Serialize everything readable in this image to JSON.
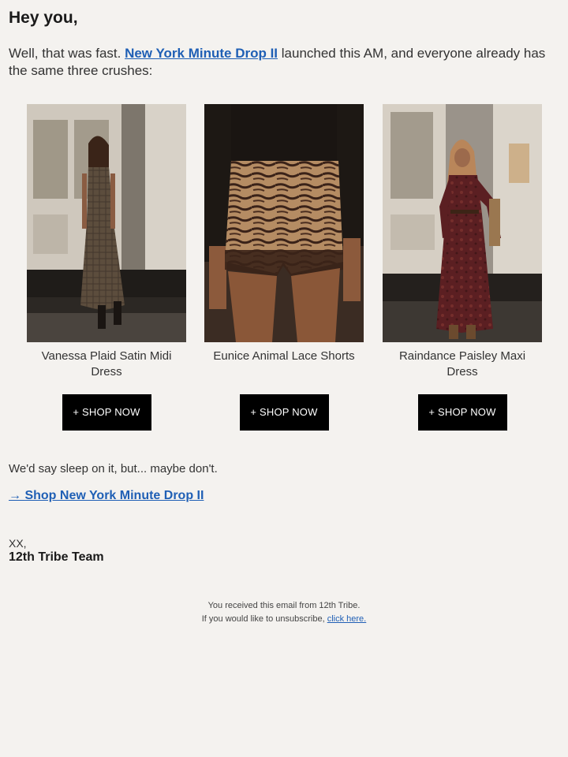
{
  "greeting": "Hey you,",
  "intro": {
    "before": "Well, that was fast. ",
    "link_text": "New York Minute Drop II",
    "after": " launched this AM, and everyone already has the same three crushes:"
  },
  "products": [
    {
      "name": "Vanessa Plaid Satin Midi Dress",
      "button": "+ SHOP NOW",
      "colors": {
        "bg": "#7a746b",
        "door": "#d6d0c6",
        "dress": "#5a4b3c",
        "step": "#2a2622"
      }
    },
    {
      "name": "Eunice Animal Lace Shorts",
      "button": "+ SHOP NOW",
      "colors": {
        "bg": "#3a2a20",
        "top": "#1b1613",
        "skin": "#8c5a3c",
        "print": "#b08a62",
        "lace": "#3b2418"
      }
    },
    {
      "name": "Raindance Paisley Maxi Dress",
      "button": "+ SHOP NOW",
      "colors": {
        "bg": "#9a938a",
        "door": "#dcd6cc",
        "dress": "#5b1f22",
        "step": "#2b2724"
      }
    }
  ],
  "closing": "We'd say sleep on it, but... maybe don't.",
  "cta": {
    "arrow": "→",
    "text": "Shop New York Minute Drop II"
  },
  "signoff": {
    "xx": "XX,",
    "team": "12th Tribe Team"
  },
  "footer": {
    "line1": "You received this email from 12th Tribe.",
    "line2_before": "If you would like to unsubscribe, ",
    "unsubscribe_link": "click here."
  },
  "colors": {
    "background": "#f4f2ef",
    "link": "#1f5fb5",
    "button": "#000000"
  }
}
